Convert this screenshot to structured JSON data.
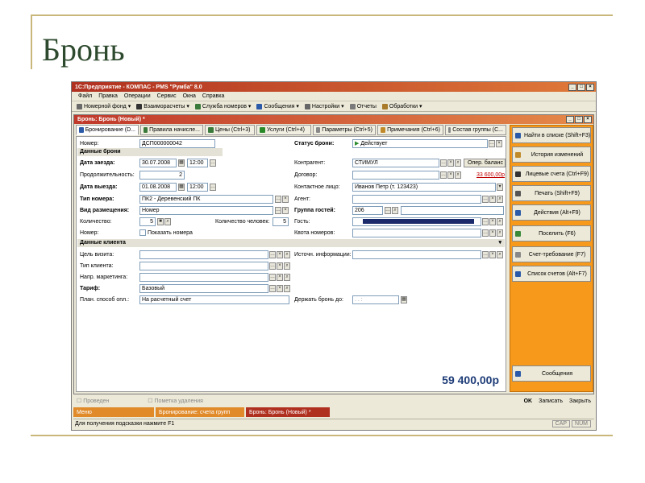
{
  "slide": {
    "title": "Бронь"
  },
  "window": {
    "title": "1С:Предприятие - КОМПАС - PMS \"Румба\" 8.0",
    "controls": [
      "_",
      "□",
      "×"
    ]
  },
  "menu": [
    "Файл",
    "Правка",
    "Операции",
    "Сервис",
    "Окна",
    "Справка"
  ],
  "toolbar": [
    {
      "label": "Номерной фонд ▾",
      "icon": "bed-icon",
      "color": "#6a6a6a"
    },
    {
      "label": "Взаиморасчеты ▾",
      "icon": "ledger-icon",
      "color": "#333333"
    },
    {
      "label": "Служба номеров ▾",
      "icon": "service-icon",
      "color": "#3a7a3a"
    },
    {
      "label": "Сообщения ▾",
      "icon": "message-icon",
      "color": "#2a5aa8"
    },
    {
      "label": "Настройки ▾",
      "icon": "settings-icon",
      "color": "#666666"
    },
    {
      "label": "Отчеты",
      "icon": "report-icon",
      "color": "#7a7a7a"
    },
    {
      "label": "Обработки ▾",
      "icon": "process-icon",
      "color": "#a87a2a"
    }
  ],
  "doc": {
    "title": "Бронь: Бронь (Новый) *",
    "controls": [
      "_",
      "□",
      "×"
    ],
    "tabs": [
      {
        "label": "Бронирование (D...",
        "icon": "search-icon",
        "color": "#2a5aa8"
      },
      {
        "label": "Правила начисле...",
        "icon": "rules-icon",
        "color": "#3a7a3a"
      },
      {
        "label": "Цены (Ctrl+3)",
        "icon": "price-icon",
        "color": "#3a7a3a"
      },
      {
        "label": "Услуги (Ctrl+4)",
        "icon": "play-icon",
        "color": "#2a8a2a"
      },
      {
        "label": "Параметры (Ctrl+5)",
        "icon": "params-icon",
        "color": "#888888"
      },
      {
        "label": "Примечания (Ctrl+6)",
        "icon": "notes-icon",
        "color": "#c08a2a"
      },
      {
        "label": "Состав группы (C...",
        "icon": "group-icon",
        "color": "#888888"
      }
    ]
  },
  "form": {
    "number_label": "Номер:",
    "number_value": "ДСП000000042",
    "status_label": "Статус брони:",
    "status_value": "Действует",
    "booking_section": "Данные брони",
    "arrival_label": "Дата заезда:",
    "arrival_date": "30.07.2008",
    "arrival_time": "12:00",
    "duration_label": "Продолжительность:",
    "duration_value": "2",
    "departure_label": "Дата выезда:",
    "departure_date": "01.08.2008",
    "departure_time": "12:00",
    "room_type_label": "Тип номера:",
    "room_type_value": "ПК2 - Деревенский ПК",
    "accommodation_label": "Вид размещения:",
    "accommodation_value": "Номер",
    "quantity_label": "Количество:",
    "quantity_value": "5",
    "persons_label": "Количество человек:",
    "persons_value": "5",
    "room_label": "Номер:",
    "show_rooms_label": "Показать номера",
    "counterparty_label": "Контрагент:",
    "counterparty_value": "СТИМУЛ",
    "balance_button": "Опер. баланс",
    "contract_label": "Договор:",
    "contract_amount": "33 600,00р",
    "contact_label": "Контактное лицо:",
    "contact_value": "Иванов Петр (т. 123423)",
    "agent_label": "Агент:",
    "guest_group_label": "Группа гостей:",
    "guest_group_value": "206",
    "guest_label": "Гость:",
    "room_quota_label": "Квота номеров:",
    "client_section": "Данные клиента",
    "visit_purpose_label": "Цель визита:",
    "client_type_label": "Тип клиента:",
    "marketing_label": "Напр. маркетинга:",
    "tariff_label": "Тариф:",
    "tariff_value": "Базовый",
    "payment_method_label": "План. способ опл.:",
    "payment_method_value": "На расчетный счет",
    "info_source_label": "Источн. информации:",
    "hold_until_label": "Держать бронь до:",
    "hold_until_value": ". .   :",
    "total": "59 400,00р"
  },
  "actions": [
    {
      "label": "Найти в списке (Shift+F3)",
      "icon": "find-icon",
      "color": "#2a5aa8"
    },
    {
      "label": "История изменений",
      "icon": "history-icon",
      "color": "#c08a2a"
    },
    {
      "label": "Лицевые счета (Ctrl+F9)",
      "icon": "accounts-icon",
      "color": "#333333"
    },
    {
      "label": "Печать (Shift+F9)",
      "icon": "print-icon",
      "color": "#555555"
    },
    {
      "label": "Действия (Alt+F9)",
      "icon": "actions-icon",
      "color": "#2a5aa8"
    },
    {
      "label": "Поселить (F6)",
      "icon": "checkin-icon",
      "color": "#3a8a3a"
    },
    {
      "label": "Счет-требование (F7)",
      "icon": "invoice-icon",
      "color": "#888888"
    },
    {
      "label": "Список счетов (Alt+F7)",
      "icon": "invoice-list-icon",
      "color": "#2a5aa8"
    },
    {
      "label": "Сообщения",
      "icon": "message-icon",
      "color": "#2a5aa8"
    }
  ],
  "status": {
    "posted": "Проведен",
    "deletion_mark": "Пометка удаления",
    "ok": "OK",
    "save": "Записать",
    "close": "Закрыть"
  },
  "taskbar": [
    "Меню",
    "Бронирование: счета групп",
    "Бронь: Бронь (Новый) *"
  ],
  "hint": {
    "text": "Для получения подсказки нажмите F1",
    "indicators": [
      "CAP",
      "NUM"
    ]
  }
}
